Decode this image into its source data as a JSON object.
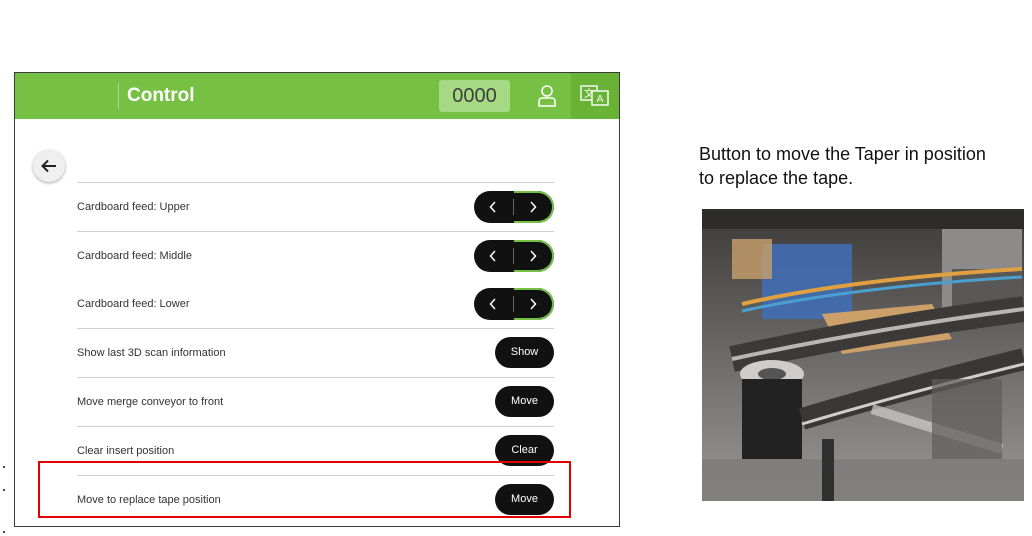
{
  "app": {
    "title": "Control",
    "counter": "0000",
    "icons": {
      "user": "user-icon",
      "language": "translate-icon",
      "back": "back-arrow-icon"
    },
    "colors": {
      "accent": "#76c043",
      "highlight": "#e00000"
    }
  },
  "rows": [
    {
      "label": "Cardboard feed: Upper",
      "control": "stepper"
    },
    {
      "label": "Cardboard feed: Middle",
      "control": "stepper"
    },
    {
      "label": "Cardboard feed: Lower",
      "control": "stepper"
    },
    {
      "label": "Show last 3D scan information",
      "button": "Show"
    },
    {
      "label": "Move merge conveyor to front",
      "button": "Move"
    },
    {
      "label": "Clear insert position",
      "button": "Clear"
    },
    {
      "label": "Move to replace tape position",
      "button": "Move"
    }
  ],
  "annotation": {
    "caption": "Button to move the Taper in position to replace the tape."
  }
}
